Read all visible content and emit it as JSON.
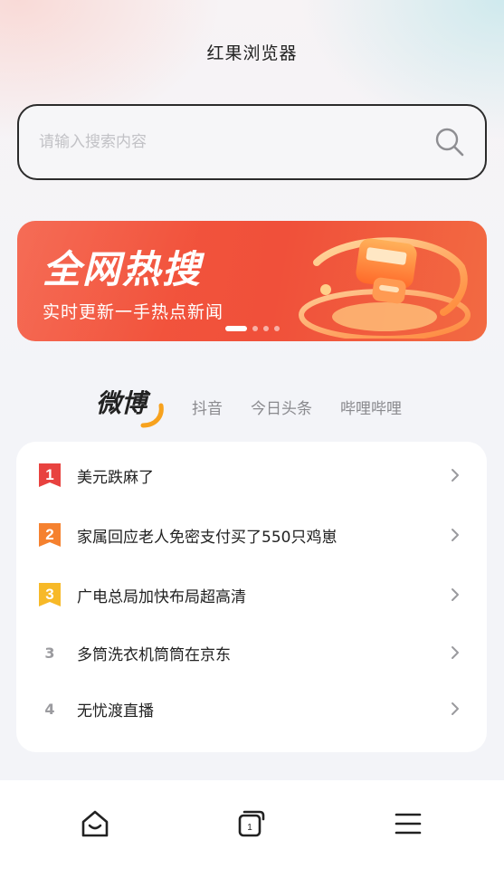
{
  "header": {
    "title": "红果浏览器"
  },
  "search": {
    "placeholder": "请输入搜索内容",
    "icon": "search-icon"
  },
  "banner": {
    "title": "全网热搜",
    "subtitle": "实时更新一手热点新闻",
    "active_dot": 1,
    "dot_count": 4
  },
  "tabs": [
    {
      "label": "微博",
      "active": true
    },
    {
      "label": "抖音",
      "active": false
    },
    {
      "label": "今日头条",
      "active": false
    },
    {
      "label": "哔哩哔哩",
      "active": false
    }
  ],
  "hot_list": [
    {
      "rank": "1",
      "title": "美元跌麻了",
      "badge_color": "#e8423f"
    },
    {
      "rank": "2",
      "title": "家属回应老人免密支付买了550只鸡崽",
      "badge_color": "#f5812f"
    },
    {
      "rank": "3",
      "title": "广电总局加快布局超高清",
      "badge_color": "#f7b928"
    },
    {
      "rank": "3",
      "title": "多筒洗衣机筒筒在京东"
    },
    {
      "rank": "4",
      "title": "无忧渡直播"
    }
  ],
  "bottom_nav": {
    "items": [
      {
        "name": "home",
        "icon": "home-icon"
      },
      {
        "name": "tabs",
        "icon": "tabs-icon",
        "count": "1"
      },
      {
        "name": "menu",
        "icon": "menu-icon"
      }
    ]
  },
  "colors": {
    "accent": "#f0503a",
    "text_primary": "#222222",
    "text_secondary": "#8a8a8e"
  }
}
